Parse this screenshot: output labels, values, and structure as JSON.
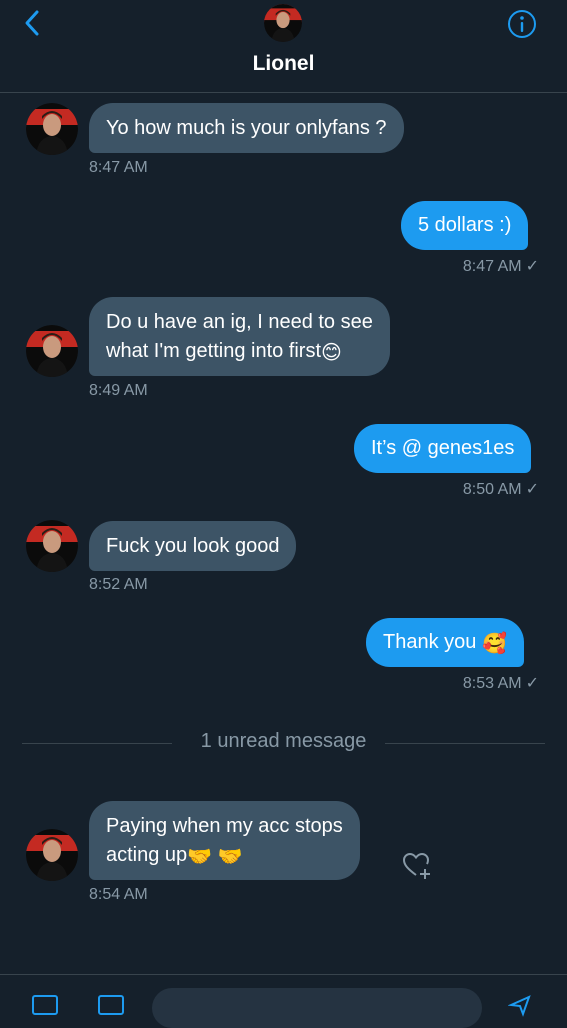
{
  "header": {
    "contact_name": "Lionel",
    "back_icon": "chevron-left-icon",
    "info_icon": "info-icon"
  },
  "colors": {
    "background": "#15202b",
    "incoming_bubble": "#3d5466",
    "outgoing_bubble": "#1d9bf0",
    "timestamp": "#8899a6",
    "accent": "#1d9bf0"
  },
  "messages": [
    {
      "direction": "incoming",
      "lines": [
        "Yo how much is your onlyfans ?"
      ],
      "time": "8:47 AM"
    },
    {
      "direction": "outgoing",
      "lines": [
        "5 dollars :)"
      ],
      "time": "8:47 AM",
      "read_mark": "✓"
    },
    {
      "direction": "incoming",
      "lines": [
        "Do u have an ig, I need to see",
        "what I'm getting into first"
      ],
      "emoji": "😊",
      "time": "8:49 AM"
    },
    {
      "direction": "outgoing",
      "lines": [
        "It’s @ genes1es"
      ],
      "time": "8:50 AM",
      "read_mark": "✓"
    },
    {
      "direction": "incoming",
      "lines": [
        "Fuck you look good"
      ],
      "time": "8:52 AM"
    },
    {
      "direction": "outgoing",
      "lines": [
        "Thank you"
      ],
      "emoji": "🥰",
      "time": "8:53 AM",
      "read_mark": "✓"
    },
    {
      "direction": "incoming",
      "lines": [
        "Paying when my acc stops",
        "acting up"
      ],
      "emoji": "🤝 🤝",
      "time": "8:54 AM"
    }
  ],
  "unread_divider": "1 unread message",
  "reaction_icon": "heart-add-icon"
}
